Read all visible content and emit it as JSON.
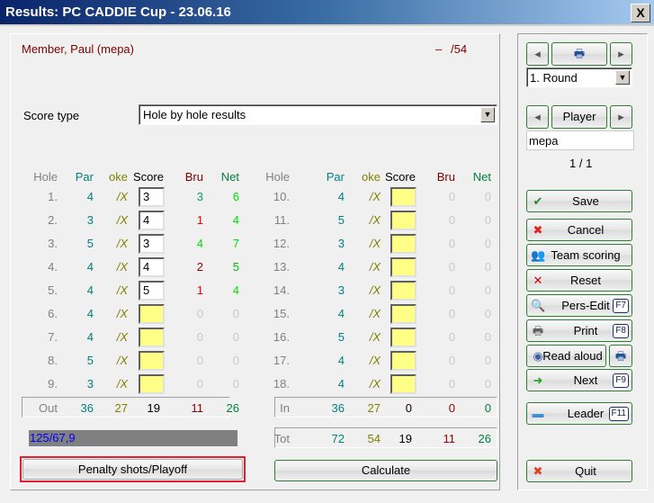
{
  "window": {
    "title": "Results: PC CADDIE Cup - 23.06.16",
    "close": "X"
  },
  "player": {
    "name": "Member, Paul (mepa)",
    "dash": "–",
    "handicap": "/54"
  },
  "score_type": {
    "label": "Score type",
    "value": "Hole by hole results"
  },
  "headers": {
    "hole": "Hole",
    "par": "Par",
    "stroke": "oke",
    "score": "Score",
    "bru": "Bru",
    "net": "Net"
  },
  "colors": {
    "par": "#008080",
    "stroke": "#808000",
    "hole": "#808080",
    "bru_header": "#800000",
    "net_header": "#008040",
    "zero": "#c8c8c8"
  },
  "front": [
    {
      "hole": "1.",
      "par": "4",
      "stroke": "/X",
      "score": "3",
      "bru": "3",
      "net": "6",
      "bru_color": "#00a070",
      "net_color": "#00e000"
    },
    {
      "hole": "2.",
      "par": "3",
      "stroke": "/X",
      "score": "4",
      "bru": "1",
      "net": "4",
      "bru_color": "#ff0000",
      "net_color": "#00e000"
    },
    {
      "hole": "3.",
      "par": "5",
      "stroke": "/X",
      "score": "3",
      "bru": "4",
      "net": "7",
      "bru_color": "#00e000",
      "net_color": "#00e000"
    },
    {
      "hole": "4.",
      "par": "4",
      "stroke": "/X",
      "score": "4",
      "bru": "2",
      "net": "5",
      "bru_color": "#900000",
      "net_color": "#00c000"
    },
    {
      "hole": "5.",
      "par": "4",
      "stroke": "/X",
      "score": "5",
      "bru": "1",
      "net": "4",
      "bru_color": "#ff0000",
      "net_color": "#00e000"
    },
    {
      "hole": "6.",
      "par": "4",
      "stroke": "/X",
      "score": "",
      "bru": "0",
      "net": "0"
    },
    {
      "hole": "7.",
      "par": "4",
      "stroke": "/X",
      "score": "",
      "bru": "0",
      "net": "0"
    },
    {
      "hole": "8.",
      "par": "5",
      "stroke": "/X",
      "score": "",
      "bru": "0",
      "net": "0"
    },
    {
      "hole": "9.",
      "par": "3",
      "stroke": "/X",
      "score": "",
      "bru": "0",
      "net": "0"
    }
  ],
  "back": [
    {
      "hole": "10.",
      "par": "4",
      "stroke": "/X",
      "score": "",
      "bru": "0",
      "net": "0"
    },
    {
      "hole": "11.",
      "par": "5",
      "stroke": "/X",
      "score": "",
      "bru": "0",
      "net": "0"
    },
    {
      "hole": "12.",
      "par": "3",
      "stroke": "/X",
      "score": "",
      "bru": "0",
      "net": "0"
    },
    {
      "hole": "13.",
      "par": "4",
      "stroke": "/X",
      "score": "",
      "bru": "0",
      "net": "0"
    },
    {
      "hole": "14.",
      "par": "3",
      "stroke": "/X",
      "score": "",
      "bru": "0",
      "net": "0"
    },
    {
      "hole": "15.",
      "par": "4",
      "stroke": "/X",
      "score": "",
      "bru": "0",
      "net": "0"
    },
    {
      "hole": "16.",
      "par": "5",
      "stroke": "/X",
      "score": "",
      "bru": "0",
      "net": "0"
    },
    {
      "hole": "17.",
      "par": "4",
      "stroke": "/X",
      "score": "",
      "bru": "0",
      "net": "0"
    },
    {
      "hole": "18.",
      "par": "4",
      "stroke": "/X",
      "score": "",
      "bru": "0",
      "net": "0"
    }
  ],
  "out": {
    "label": "Out",
    "par": "36",
    "stroke": "27",
    "score": "19",
    "bru": "11",
    "net": "26"
  },
  "in": {
    "label": "In",
    "par": "36",
    "stroke": "27",
    "score": "0",
    "bru": "0",
    "net": "0"
  },
  "tot": {
    "label": "Tot",
    "par": "72",
    "stroke": "54",
    "score": "19",
    "bru": "11",
    "net": "26"
  },
  "course_rating": "125/67,9",
  "buttons": {
    "penalty": "Penalty shots/Playoff",
    "calculate": "Calculate"
  },
  "nav": {
    "round": "1. Round",
    "player": "Player",
    "search": "mepa",
    "count": "1 / 1"
  },
  "side_buttons": [
    {
      "label": "Save",
      "icon": "check-icon",
      "glyph": "✔",
      "color": "#2a8a2a",
      "key": ""
    },
    {
      "label": "Cancel",
      "icon": "cancel-icon",
      "glyph": "✖",
      "color": "#e02020",
      "key": ""
    },
    {
      "label": "Team scoring",
      "icon": "team-icon",
      "glyph": "👥",
      "color": "#c06000",
      "key": ""
    },
    {
      "label": "Reset",
      "icon": "reset-x-icon",
      "glyph": "✕",
      "color": "#d00000",
      "key": ""
    },
    {
      "label": "Pers-Edit",
      "icon": "person-search-icon",
      "glyph": "🔍",
      "color": "#2060c0",
      "key": "F7"
    },
    {
      "label": "Print",
      "icon": "printer-icon",
      "glyph": "🖶",
      "color": "#606060",
      "key": "F8"
    },
    {
      "label": "Read aloud",
      "icon": "speaker-icon",
      "glyph": "◉",
      "color": "#4060a0",
      "key": ""
    },
    {
      "label": "Next",
      "icon": "next-arrow-icon",
      "glyph": "➜",
      "color": "#20a020",
      "key": "F9"
    },
    {
      "label": "Leader",
      "icon": "leader-icon",
      "glyph": "▬",
      "color": "#4090d0",
      "key": "F11"
    },
    {
      "label": "Quit",
      "icon": "quit-icon",
      "glyph": "✖",
      "color": "#e04020",
      "key": ""
    }
  ]
}
